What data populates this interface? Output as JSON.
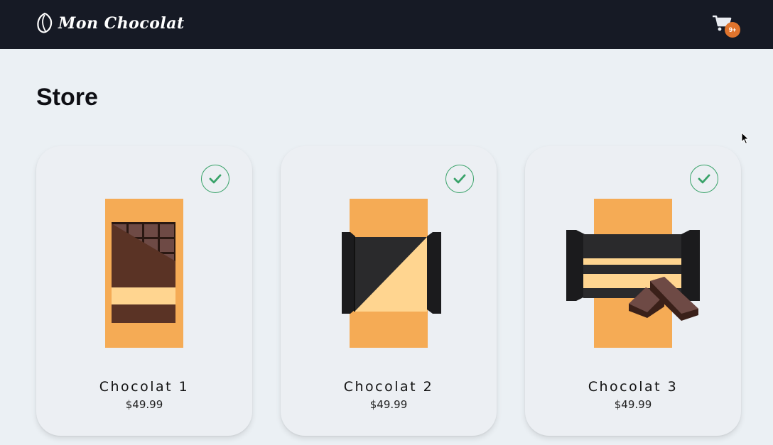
{
  "app": {
    "brand_name": "Mon Chocolat",
    "brand_icon": "cocoa-bean-icon"
  },
  "header": {
    "cart_icon": "shopping-cart-icon",
    "cart_badge": "9+"
  },
  "page": {
    "title": "Store"
  },
  "products": [
    {
      "name": "Chocolat 1",
      "price": "$49.99",
      "selected": true,
      "selected_icon": "check-circle-icon"
    },
    {
      "name": "Chocolat 2",
      "price": "$49.99",
      "selected": true,
      "selected_icon": "check-circle-icon"
    },
    {
      "name": "Chocolat 3",
      "price": "$49.99",
      "selected": true,
      "selected_icon": "check-circle-icon"
    }
  ],
  "colors": {
    "header_bg": "#161a25",
    "page_bg": "#ebf0f4",
    "accent_orange": "#f5ab55",
    "badge_orange": "#e0742d",
    "check_green": "#3aa36a",
    "chocolate_dark": "#5a3325",
    "cream": "#ffd590",
    "wrapper_black": "#2a2a2c"
  }
}
